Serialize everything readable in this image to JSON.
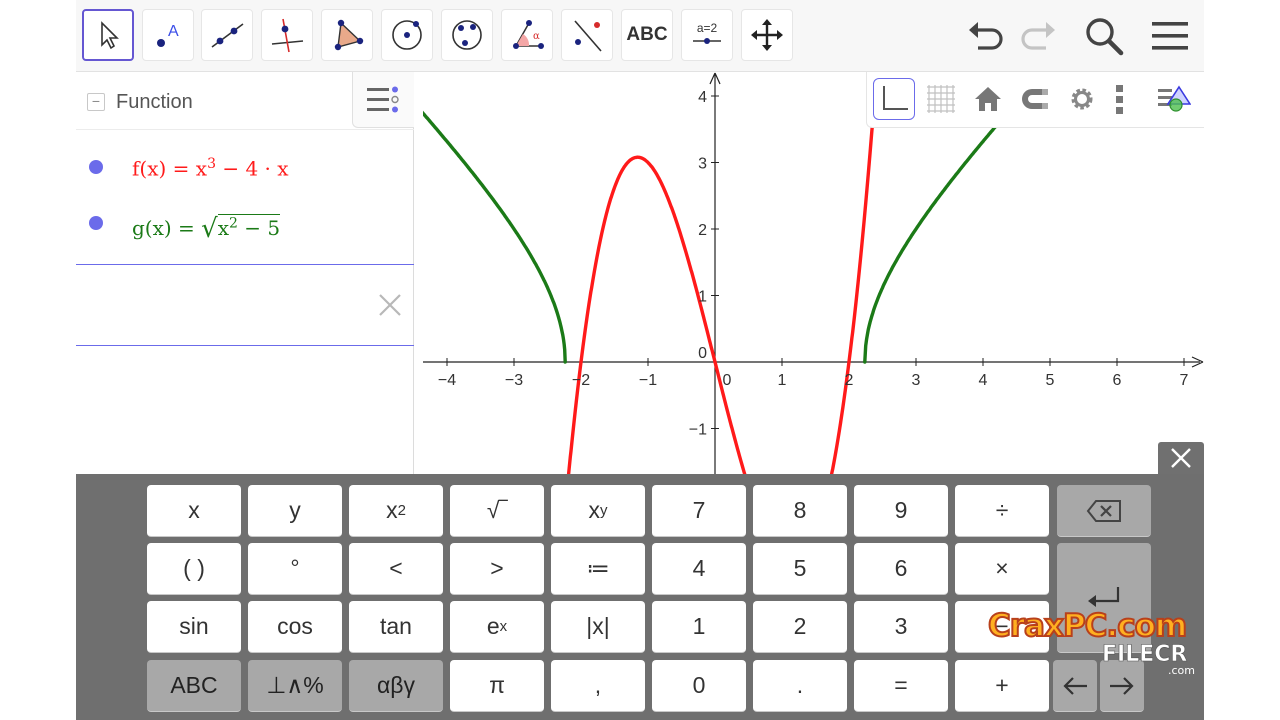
{
  "colors": {
    "accent": "#6557d2",
    "function_f": "#ff1a1a",
    "function_g": "#1b7a17",
    "point": "#6b6bea",
    "keyboard_bg": "#6f6f6f"
  },
  "toolbar": {
    "tools": [
      {
        "name": "move-tool-icon"
      },
      {
        "name": "point-tool-icon"
      },
      {
        "name": "line-tool-icon"
      },
      {
        "name": "perpendicular-line-tool-icon"
      },
      {
        "name": "polygon-tool-icon"
      },
      {
        "name": "circle-tool-icon"
      },
      {
        "name": "conic-tool-icon"
      },
      {
        "name": "angle-tool-icon"
      },
      {
        "name": "reflect-tool-icon"
      },
      {
        "name": "text-tool",
        "label": "ABC"
      },
      {
        "name": "slider-tool",
        "label": "a=2"
      },
      {
        "name": "move-graphics-view-icon"
      }
    ],
    "right_icons": [
      "undo-icon",
      "redo-icon",
      "search-icon",
      "menu-icon"
    ]
  },
  "algebra": {
    "header": "Function",
    "items": [
      {
        "lhs": "f(x)",
        "eq": "=",
        "base": "x",
        "exp": "3",
        "rest": " − 4 · x"
      },
      {
        "lhs": "g(x)",
        "eq": "=",
        "radicand_base": "x",
        "radicand_exp": "2",
        "radicand_rest": " − 5"
      }
    ]
  },
  "graphics": {
    "style_bar_icons": [
      "axes-icon",
      "grid-icon",
      "home-icon",
      "magnet-icon",
      "gear-icon",
      "more-vert-icon",
      "view-toggle-icon"
    ],
    "x_ticks": [
      "−4",
      "−3",
      "−2",
      "−1",
      "0",
      "1",
      "2",
      "3",
      "4",
      "5",
      "6",
      "7"
    ],
    "y_ticks": [
      "4",
      "3",
      "2",
      "1",
      "0",
      "−1"
    ]
  },
  "chart_data": {
    "type": "line",
    "series": [
      {
        "name": "f(x) = x³ − 4·x",
        "color": "#ff1a1a",
        "x_range": [
          -4.5,
          7.5
        ]
      },
      {
        "name": "g(x) = √(x² − 5)",
        "color": "#1b7a17",
        "x_range": [
          -4.5,
          7.5
        ]
      }
    ],
    "xlim": [
      -4.4,
      7.3
    ],
    "ylim": [
      -1.7,
      4.3
    ],
    "grid": false
  },
  "keyboard": {
    "rows": [
      [
        {
          "name": "key-x",
          "label": "x"
        },
        {
          "name": "key-y",
          "label": "y"
        },
        {
          "name": "key-x-squared",
          "base": "x",
          "sup": "2"
        },
        {
          "name": "key-sqrt",
          "label": "√‾"
        },
        {
          "name": "key-x-power-y",
          "base": "x",
          "sup": "y"
        },
        {
          "name": "key-7",
          "label": "7"
        },
        {
          "name": "key-8",
          "label": "8"
        },
        {
          "name": "key-9",
          "label": "9"
        },
        {
          "name": "key-divide",
          "label": "÷"
        }
      ],
      [
        {
          "name": "key-parentheses",
          "label": "( )"
        },
        {
          "name": "key-degree",
          "label": "°"
        },
        {
          "name": "key-less-than",
          "label": "<"
        },
        {
          "name": "key-greater-than",
          "label": ">"
        },
        {
          "name": "key-assign",
          "label": "≔"
        },
        {
          "name": "key-4",
          "label": "4"
        },
        {
          "name": "key-5",
          "label": "5"
        },
        {
          "name": "key-6",
          "label": "6"
        },
        {
          "name": "key-multiply",
          "label": "×"
        }
      ],
      [
        {
          "name": "key-sin",
          "label": "sin"
        },
        {
          "name": "key-cos",
          "label": "cos"
        },
        {
          "name": "key-tan",
          "label": "tan"
        },
        {
          "name": "key-e-power-x",
          "base": "e",
          "sup": "x"
        },
        {
          "name": "key-abs",
          "label": "|x|"
        },
        {
          "name": "key-1",
          "label": "1"
        },
        {
          "name": "key-2",
          "label": "2"
        },
        {
          "name": "key-3",
          "label": "3"
        },
        {
          "name": "key-minus",
          "label": "−"
        }
      ],
      [
        {
          "name": "key-abc",
          "label": "ABC",
          "style": "func"
        },
        {
          "name": "key-logic-symbols",
          "label": "⊥∧%",
          "style": "func"
        },
        {
          "name": "key-greek",
          "label": "αβγ",
          "style": "func"
        },
        {
          "name": "key-pi",
          "label": "π"
        },
        {
          "name": "key-comma",
          "label": ","
        },
        {
          "name": "key-0",
          "label": "0"
        },
        {
          "name": "key-decimal",
          "label": "."
        },
        {
          "name": "key-equals",
          "label": "="
        },
        {
          "name": "key-plus",
          "label": "+"
        }
      ]
    ]
  },
  "watermark": {
    "line1": "CraxPC.com",
    "line2": "FILECR",
    "line3": ".com"
  }
}
